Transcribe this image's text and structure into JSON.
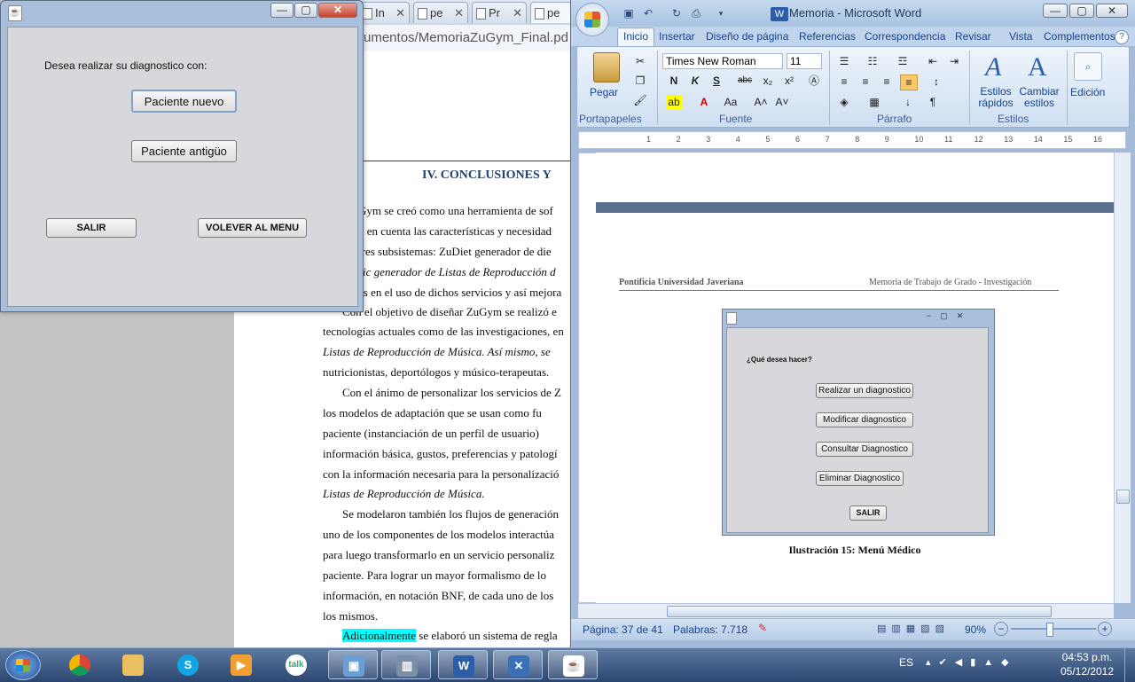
{
  "browser": {
    "tabs": [
      {
        "label": "In"
      },
      {
        "label": "pe"
      },
      {
        "label": "Pr"
      },
      {
        "label": "pe"
      }
    ],
    "address": "umentos/MemoriaZuGym_Final.pd",
    "doc_lines": [
      {
        "text": "IV.    CONCLUSIONES Y"
      },
      {
        "text": "Gym se creó como una herramienta de sof"
      },
      {
        "text": "o en cuenta las características y necesidad"
      },
      {
        "text": "tres subsistemas: ZuDiet generador de die"
      },
      {
        "text": "sic generador de Listas de Reproducción d"
      },
      {
        "text": "es en el uso de dichos servicios y así mejora"
      },
      {
        "text": "Con el objetivo de diseñar ZuGym se realizó e"
      },
      {
        "text": "tecnologías actuales como de las investigaciones, en"
      },
      {
        "text": "Listas de Reproducción de Música. Así mismo, se"
      },
      {
        "text": "nutricionistas, deportólogos y músico-terapeutas."
      },
      {
        "text": "Con el ánimo de personalizar los servicios de Z"
      },
      {
        "text": "los modelos de adaptación que se usan como fu"
      },
      {
        "text": "paciente (instanciación de un perfil de usuario)"
      },
      {
        "text": "información básica, gustos, preferencias y patologí"
      },
      {
        "text": "con la información necesaria para la personalizació"
      },
      {
        "text": "Listas de Reproducción de Música."
      },
      {
        "text": "Se modelaron también los flujos de generación"
      },
      {
        "text": "uno de los componentes de los modelos interactúa"
      },
      {
        "text": "para luego transformarlo en un servicio personaliz"
      },
      {
        "text": "paciente. Para lograr un mayor formalismo de lo"
      },
      {
        "text": "información, en notación BNF, de cada uno de los"
      },
      {
        "text": "los mismos."
      },
      {
        "text": "Adicionalmente"
      },
      {
        "text": "se elaboró un sistema de regla"
      }
    ]
  },
  "java_dialog": {
    "prompt": "Desea realizar su diagnostico con:",
    "new_patient": "Paciente nuevo",
    "old_patient": "Paciente antigüo",
    "exit": "SALIR",
    "back_menu": "VOLEVER AL MENU",
    "minimize": "—",
    "maximize": "▢",
    "close": "✕"
  },
  "word": {
    "title": "Memoria - Microsoft Word",
    "tabs": [
      "Inicio",
      "Insertar",
      "Diseño de página",
      "Referencias",
      "Correspondencia",
      "Revisar",
      "Vista",
      "Complementos"
    ],
    "font_name": "Times New Roman",
    "font_size": "11",
    "groups": {
      "clipboard": "Portapapeles",
      "font": "Fuente",
      "paragraph": "Párrafo",
      "styles": "Estilos",
      "edit": "Edición"
    },
    "paste_label": "Pegar",
    "quick_styles": "Estilos rápidos",
    "change_styles": "Cambiar estilos",
    "edit_label": "Edición",
    "ruler_numbers": [
      "1",
      "2",
      "3",
      "4",
      "5",
      "6",
      "7",
      "8",
      "9",
      "10",
      "11",
      "12",
      "13",
      "14",
      "15",
      "16"
    ],
    "header_left": "Pontificia Universidad Javeriana",
    "header_right": "Memoria de Trabajo de Grado - Investigación",
    "figure": {
      "prompt": "¿Qué desea hacer?",
      "btn1": "Realizar un diagnostico",
      "btn2": "Modificar diagnostico",
      "btn3": "Consultar Diagnostico",
      "btn4": "Eliminar Diagnostico",
      "exit": "SALIR"
    },
    "caption": "Ilustración 15: Menú Médico",
    "status": {
      "page": "Página: 37 de 41",
      "words": "Palabras: 7.718",
      "zoom": "90%"
    }
  },
  "taskbar": {
    "lang": "ES",
    "time": "04:53 p.m.",
    "date": "05/12/2012"
  }
}
